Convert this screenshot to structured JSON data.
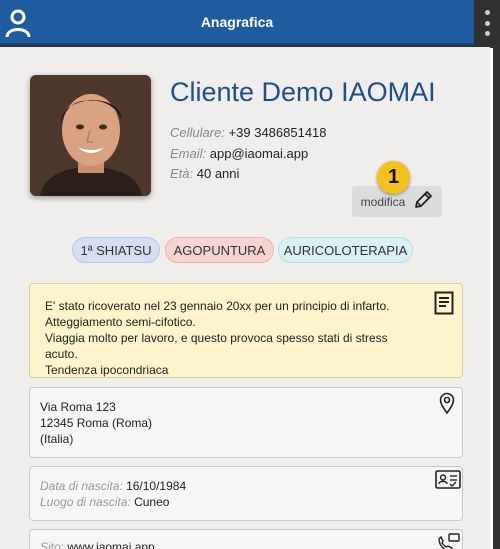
{
  "header": {
    "title": "Anagrafica"
  },
  "client": {
    "name": "Cliente Demo IAOMAI",
    "phone_label": "Cellulare:",
    "phone": "+39 3486851418",
    "email_label": "Email:",
    "email": "app@iaomai.app",
    "age_label": "Età:",
    "age": "40 anni"
  },
  "edit": {
    "label": "modifica",
    "badge": "1"
  },
  "tags": [
    "1ª SHIATSU",
    "AGOPUNTURA",
    "AURICOLOTERAPIA"
  ],
  "note": {
    "lines": [
      "E' stato ricoverato nel 23 gennaio 20xx per un principio di infarto.",
      "Atteggiamento semi-cifotico.",
      "Viaggia molto per lavoro, e questo provoca spesso stati di stress acuto.",
      "Tendenza ipocondriaca"
    ]
  },
  "address": {
    "street": "Via Roma 123",
    "city": "12345 Roma (Roma)",
    "country": "(Italia)"
  },
  "birth": {
    "date_label": "Data di nascita:",
    "date": "16/10/1984",
    "place_label": "Luogo di nascita:",
    "place": "Cuneo"
  },
  "site": {
    "label": "Sito:",
    "value": "www.iaomai.app"
  },
  "colors": {
    "header": "#1f5c9f",
    "name": "#1d4f88",
    "badge": "#f2c21b",
    "note_bg": "#fdf4cc"
  }
}
